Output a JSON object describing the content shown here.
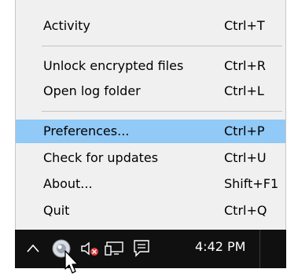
{
  "menu": {
    "items": [
      {
        "label": "Activity",
        "shortcut": "Ctrl+T"
      },
      {
        "label": "Unlock encrypted files",
        "shortcut": "Ctrl+R"
      },
      {
        "label": "Open log folder",
        "shortcut": "Ctrl+L"
      },
      {
        "label": "Preferences...",
        "shortcut": "Ctrl+P"
      },
      {
        "label": "Check for updates",
        "shortcut": "Ctrl+U"
      },
      {
        "label": "About...",
        "shortcut": "Shift+F1"
      },
      {
        "label": "Quit",
        "shortcut": "Ctrl+Q"
      }
    ],
    "highlight_color": "#91c9f7"
  },
  "taskbar": {
    "clock": "4:42 PM",
    "background": "#101010",
    "icons": [
      "chevron-up-icon",
      "app-tray-icon",
      "speaker-muted-icon",
      "network-icon",
      "action-center-icon"
    ]
  }
}
